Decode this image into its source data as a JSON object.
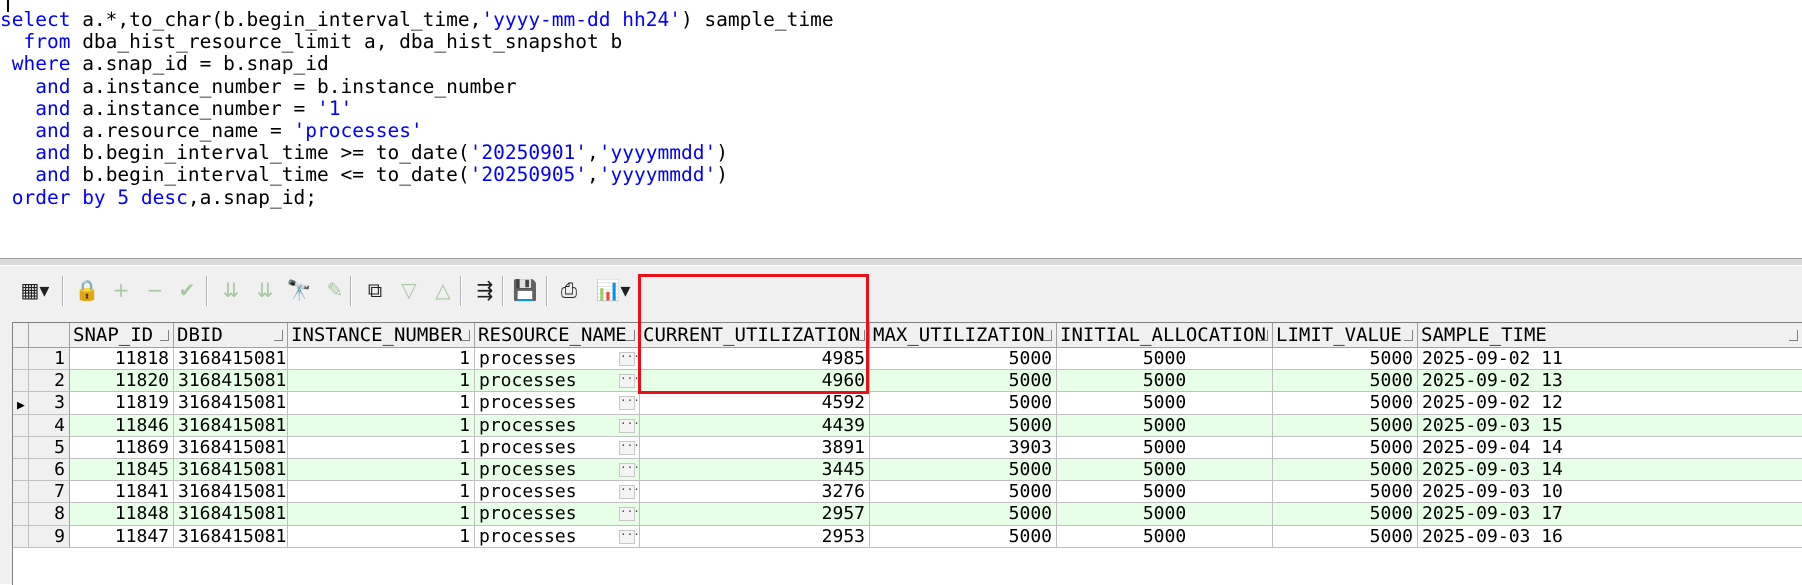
{
  "editor": {
    "lines": [
      [
        {
          "t": "select",
          "c": "kw"
        },
        {
          "t": " a.*,to_char(b.begin_interval_time,"
        },
        {
          "t": "'yyyy-mm-dd hh24'",
          "c": "str"
        },
        {
          "t": ") sample_time"
        }
      ],
      [
        {
          "t": "  "
        },
        {
          "t": "from",
          "c": "kw"
        },
        {
          "t": " dba_hist_resource_limit a, dba_hist_snapshot b"
        }
      ],
      [
        {
          "t": " "
        },
        {
          "t": "where",
          "c": "kw"
        },
        {
          "t": " a.snap_id = b.snap_id"
        }
      ],
      [
        {
          "t": "   "
        },
        {
          "t": "and",
          "c": "kw"
        },
        {
          "t": " a.instance_number = b.instance_number"
        }
      ],
      [
        {
          "t": "   "
        },
        {
          "t": "and",
          "c": "kw"
        },
        {
          "t": " a.instance_number = "
        },
        {
          "t": "'1'",
          "c": "str"
        }
      ],
      [
        {
          "t": "   "
        },
        {
          "t": "and",
          "c": "kw"
        },
        {
          "t": " a.resource_name = "
        },
        {
          "t": "'processes'",
          "c": "str"
        }
      ],
      [
        {
          "t": "   "
        },
        {
          "t": "and",
          "c": "kw"
        },
        {
          "t": " b.begin_interval_time >= to_date("
        },
        {
          "t": "'20250901'",
          "c": "str"
        },
        {
          "t": ","
        },
        {
          "t": "'yyyymmdd'",
          "c": "str"
        },
        {
          "t": ")"
        }
      ],
      [
        {
          "t": "   "
        },
        {
          "t": "and",
          "c": "kw"
        },
        {
          "t": " b.begin_interval_time <= to_date("
        },
        {
          "t": "'20250905'",
          "c": "str"
        },
        {
          "t": ","
        },
        {
          "t": "'yyyymmdd'",
          "c": "str"
        },
        {
          "t": ")"
        }
      ],
      [
        {
          "t": " "
        },
        {
          "t": "order by 5 desc",
          "c": "kw"
        },
        {
          "t": ",a.snap_id;"
        }
      ]
    ]
  },
  "toolbar": {
    "buttons": [
      {
        "name": "grid-options-icon",
        "glyph": "▦▾",
        "enabled": true
      },
      {
        "name": "lock-icon",
        "glyph": "🔒",
        "enabled": true
      },
      {
        "name": "add-record-icon",
        "glyph": "+",
        "enabled": false
      },
      {
        "name": "delete-record-icon",
        "glyph": "−",
        "enabled": false
      },
      {
        "name": "post-changes-icon",
        "glyph": "✔",
        "enabled": false
      },
      {
        "name": "fetch-next-icon",
        "glyph": "⇊",
        "enabled": false
      },
      {
        "name": "fetch-last-icon",
        "glyph": "⇊",
        "enabled": false
      },
      {
        "name": "find-icon",
        "glyph": "🔭",
        "enabled": true
      },
      {
        "name": "clear-icon",
        "glyph": "✎",
        "enabled": false
      },
      {
        "name": "query-by-example-icon",
        "glyph": "⧉",
        "enabled": true
      },
      {
        "name": "previous-record-icon",
        "glyph": "▽",
        "enabled": false
      },
      {
        "name": "next-record-icon",
        "glyph": "△",
        "enabled": false
      },
      {
        "name": "export-query-results-icon",
        "glyph": "⇶",
        "enabled": true
      },
      {
        "name": "save-icon",
        "glyph": "💾",
        "enabled": true
      },
      {
        "name": "print-icon",
        "glyph": "⎙",
        "enabled": true
      },
      {
        "name": "chart-icon",
        "glyph": "📊▾",
        "enabled": true
      }
    ]
  },
  "grid": {
    "columns": [
      "SNAP_ID",
      "DBID",
      "INSTANCE_NUMBER",
      "RESOURCE_NAME",
      "CURRENT_UTILIZATION",
      "MAX_UTILIZATION",
      "INITIAL_ALLOCATION",
      "LIMIT_VALUE",
      "SAMPLE_TIME"
    ],
    "current_row": 3,
    "rows": [
      [
        "1",
        "11818",
        "3168415081",
        "1",
        "processes",
        "4985",
        "5000",
        "5000",
        "5000",
        "2025-09-02 11"
      ],
      [
        "2",
        "11820",
        "3168415081",
        "1",
        "processes",
        "4960",
        "5000",
        "5000",
        "5000",
        "2025-09-02 13"
      ],
      [
        "3",
        "11819",
        "3168415081",
        "1",
        "processes",
        "4592",
        "5000",
        "5000",
        "5000",
        "2025-09-02 12"
      ],
      [
        "4",
        "11846",
        "3168415081",
        "1",
        "processes",
        "4439",
        "5000",
        "5000",
        "5000",
        "2025-09-03 15"
      ],
      [
        "5",
        "11869",
        "3168415081",
        "1",
        "processes",
        "3891",
        "3903",
        "5000",
        "5000",
        "2025-09-04 14"
      ],
      [
        "6",
        "11845",
        "3168415081",
        "1",
        "processes",
        "3445",
        "5000",
        "5000",
        "5000",
        "2025-09-03 14"
      ],
      [
        "7",
        "11841",
        "3168415081",
        "1",
        "processes",
        "3276",
        "5000",
        "5000",
        "5000",
        "2025-09-03 10"
      ],
      [
        "8",
        "11848",
        "3168415081",
        "1",
        "processes",
        "2957",
        "5000",
        "5000",
        "5000",
        "2025-09-03 17"
      ],
      [
        "9",
        "11847",
        "3168415081",
        "1",
        "processes",
        "2953",
        "5000",
        "5000",
        "5000",
        "2025-09-03 16"
      ]
    ]
  },
  "colors": {
    "row_even_bg": "#e6ffe6",
    "row_odd_bg": "#ffffff",
    "keyword": "#0000ff",
    "highlight_box": "#e8101a"
  }
}
